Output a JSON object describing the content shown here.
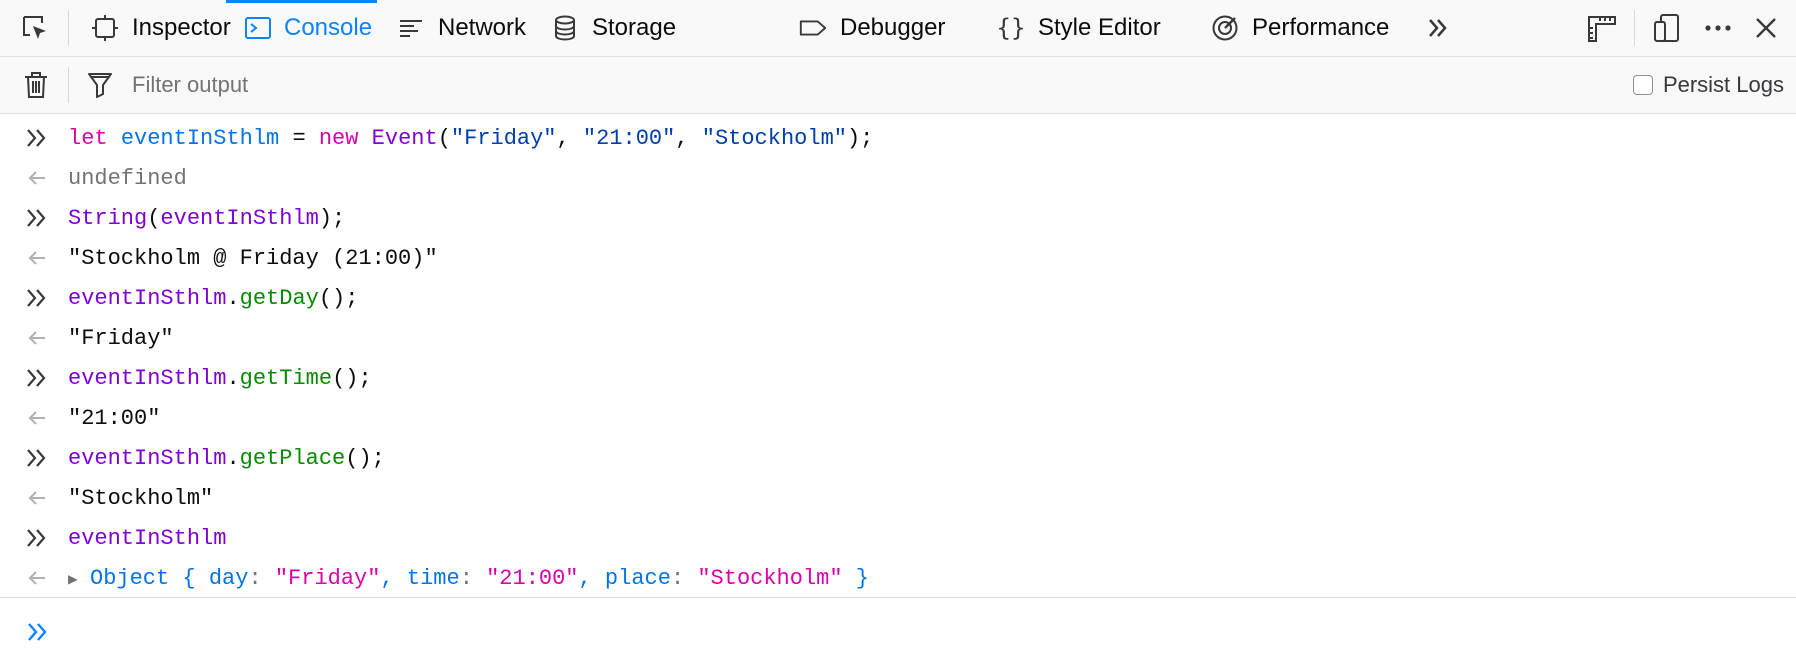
{
  "toolbar": {
    "tabs": [
      {
        "label": "Inspector",
        "icon": "inspector-icon"
      },
      {
        "label": "Console",
        "icon": "console-icon",
        "active": true
      },
      {
        "label": "Network",
        "icon": "network-icon"
      },
      {
        "label": "Storage",
        "icon": "storage-icon"
      },
      {
        "label": "Debugger",
        "icon": "debugger-icon"
      },
      {
        "label": "Style Editor",
        "icon": "style-editor-icon"
      },
      {
        "label": "Performance",
        "icon": "performance-icon"
      }
    ],
    "overflow_icon": "chevrons-right-icon",
    "right_icons": [
      "measure-icon",
      "responsive-design-icon",
      "more-icon",
      "close-icon"
    ]
  },
  "filter_bar": {
    "placeholder": "Filter output",
    "persist_logs_label": "Persist Logs",
    "persist_logs_checked": false
  },
  "console": {
    "rows": [
      {
        "type": "input",
        "tokens": [
          {
            "t": "let",
            "c": "kw"
          },
          {
            "t": " ",
            "c": "txt"
          },
          {
            "t": "eventInSthlm",
            "c": "var"
          },
          {
            "t": " = ",
            "c": "txt"
          },
          {
            "t": "new",
            "c": "kw"
          },
          {
            "t": " ",
            "c": "txt"
          },
          {
            "t": "Event",
            "c": "fn"
          },
          {
            "t": "(",
            "c": "txt"
          },
          {
            "t": "\"Friday\"",
            "c": "str"
          },
          {
            "t": ", ",
            "c": "txt"
          },
          {
            "t": "\"21:00\"",
            "c": "str"
          },
          {
            "t": ", ",
            "c": "txt"
          },
          {
            "t": "\"Stockholm\"",
            "c": "str"
          },
          {
            "t": ");",
            "c": "txt"
          }
        ]
      },
      {
        "type": "result",
        "tokens": [
          {
            "t": "undefined",
            "c": "dim"
          }
        ]
      },
      {
        "type": "input",
        "tokens": [
          {
            "t": "String",
            "c": "fn"
          },
          {
            "t": "(",
            "c": "txt"
          },
          {
            "t": "eventInSthlm",
            "c": "fn"
          },
          {
            "t": ");",
            "c": "txt"
          }
        ]
      },
      {
        "type": "result",
        "tokens": [
          {
            "t": "\"Stockholm @ Friday (21:00)\"",
            "c": "txt"
          }
        ]
      },
      {
        "type": "input",
        "tokens": [
          {
            "t": "eventInSthlm",
            "c": "fn"
          },
          {
            "t": ".",
            "c": "txt"
          },
          {
            "t": "getDay",
            "c": "meth"
          },
          {
            "t": "();",
            "c": "txt"
          }
        ]
      },
      {
        "type": "result",
        "tokens": [
          {
            "t": "\"Friday\"",
            "c": "txt"
          }
        ]
      },
      {
        "type": "input",
        "tokens": [
          {
            "t": "eventInSthlm",
            "c": "fn"
          },
          {
            "t": ".",
            "c": "txt"
          },
          {
            "t": "getTime",
            "c": "meth"
          },
          {
            "t": "();",
            "c": "txt"
          }
        ]
      },
      {
        "type": "result",
        "tokens": [
          {
            "t": "\"21:00\"",
            "c": "txt"
          }
        ]
      },
      {
        "type": "input",
        "tokens": [
          {
            "t": "eventInSthlm",
            "c": "fn"
          },
          {
            "t": ".",
            "c": "txt"
          },
          {
            "t": "getPlace",
            "c": "meth"
          },
          {
            "t": "();",
            "c": "txt"
          }
        ]
      },
      {
        "type": "result",
        "tokens": [
          {
            "t": "\"Stockholm\"",
            "c": "txt"
          }
        ]
      },
      {
        "type": "input",
        "tokens": [
          {
            "t": "eventInSthlm",
            "c": "fn"
          }
        ]
      },
      {
        "type": "object",
        "tokens": [
          {
            "t": "Object",
            "c": "obj-name"
          },
          {
            "t": " { ",
            "c": "obj-name"
          },
          {
            "t": "day",
            "c": "obj-key"
          },
          {
            "t": ": ",
            "c": "dim"
          },
          {
            "t": "\"Friday\"",
            "c": "obj-str"
          },
          {
            "t": ", ",
            "c": "obj-name"
          },
          {
            "t": "time",
            "c": "obj-key"
          },
          {
            "t": ": ",
            "c": "dim"
          },
          {
            "t": "\"21:00\"",
            "c": "obj-str"
          },
          {
            "t": ", ",
            "c": "obj-name"
          },
          {
            "t": "place",
            "c": "obj-key"
          },
          {
            "t": ": ",
            "c": "dim"
          },
          {
            "t": "\"Stockholm\"",
            "c": "obj-str"
          },
          {
            "t": " }",
            "c": "obj-name"
          }
        ]
      }
    ],
    "input_value": ""
  },
  "colors": {
    "accent": "#0a84ff",
    "keyword": "#dd00a9",
    "variable": "#0074e8",
    "string": "#003eaa",
    "function": "#8000d7",
    "method": "#058b00",
    "muted": "#737373"
  }
}
